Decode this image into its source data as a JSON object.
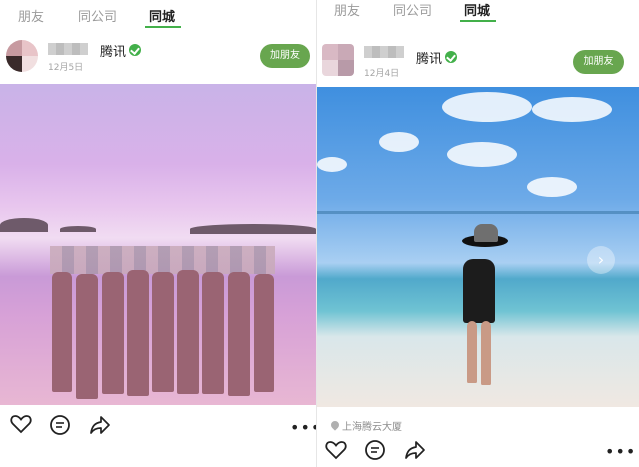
{
  "left": {
    "tabs": [
      {
        "label": "朋友",
        "active": false
      },
      {
        "label": "同公司",
        "active": false
      },
      {
        "label": "同城",
        "active": true
      }
    ],
    "post": {
      "company": "腾讯",
      "date": "12月5日",
      "add_friend": "加朋友"
    }
  },
  "right": {
    "tabs": [
      {
        "label": "朋友",
        "active": false
      },
      {
        "label": "同公司",
        "active": false
      },
      {
        "label": "同城",
        "active": true
      }
    ],
    "post": {
      "company": "腾讯",
      "date": "12月4日",
      "add_friend": "加朋友",
      "location": "上海腾云大厦"
    },
    "next_icon": "chevron-right"
  },
  "icons": [
    "heart-icon",
    "comment-icon",
    "share-icon",
    "more-icon",
    "verified-icon",
    "location-pin-icon"
  ],
  "colors": {
    "accent": "#43b04a",
    "button": "#68a64f"
  }
}
